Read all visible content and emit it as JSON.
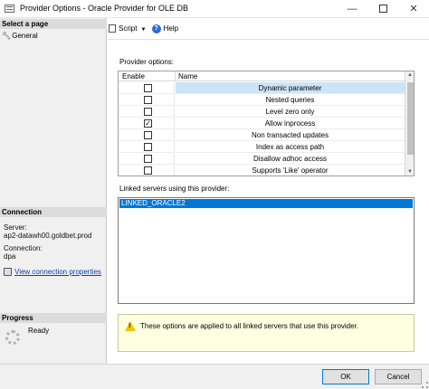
{
  "window": {
    "title": "Provider Options - Oracle Provider for OLE DB",
    "minimize": "—",
    "close": "✕"
  },
  "sidebar": {
    "select_page": "Select a page",
    "items": [
      {
        "label": "General",
        "icon": "wrench-icon"
      }
    ],
    "connection_header": "Connection",
    "server_label": "Server:",
    "server_value": "ap2-datawh00.goldbet.prod",
    "connection_label": "Connection:",
    "connection_value": "dpa",
    "view_props_link": "View connection properties",
    "progress_header": "Progress",
    "progress_status": "Ready"
  },
  "toolbar": {
    "script_label": "Script",
    "help_label": "Help"
  },
  "provider_options": {
    "label": "Provider options:",
    "columns": [
      "Enable",
      "Name"
    ],
    "rows": [
      {
        "name": "Dynamic parameter",
        "checked": false,
        "selected": true
      },
      {
        "name": "Nested queries",
        "checked": false,
        "selected": false
      },
      {
        "name": "Level zero only",
        "checked": false,
        "selected": false
      },
      {
        "name": "Allow inprocess",
        "checked": true,
        "selected": false
      },
      {
        "name": "Non transacted updates",
        "checked": false,
        "selected": false
      },
      {
        "name": "Index as access path",
        "checked": false,
        "selected": false
      },
      {
        "name": "Disallow adhoc access",
        "checked": false,
        "selected": false
      },
      {
        "name": "Supports 'Like' operator",
        "checked": false,
        "selected": false
      }
    ]
  },
  "linked_servers": {
    "label": "Linked servers using this provider:",
    "items": [
      "LINKED_ORACLE2"
    ]
  },
  "notice": {
    "text": "These options are applied to all linked servers that use this provider."
  },
  "buttons": {
    "ok": "OK",
    "cancel": "Cancel"
  },
  "colors": {
    "selection": "#0078d7",
    "row_highlight": "#cce4f7",
    "warning_bg": "#ffffe1"
  }
}
